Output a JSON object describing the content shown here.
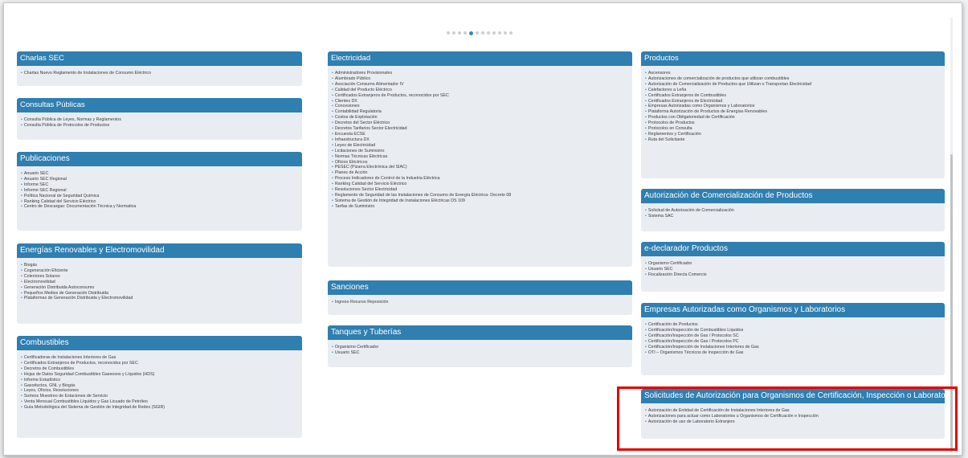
{
  "carousel": {
    "dot_count": 12,
    "active_index": 4
  },
  "columns": [
    [
      {
        "key": "charlas",
        "title": "Charlas SEC",
        "items": [
          "Charlas Nuevo Reglamento de Instalaciones de Consumo Eléctrico"
        ]
      },
      {
        "key": "consultas",
        "title": "Consultas Públicas",
        "items": [
          "Consulta Pública de Leyes, Normas y Reglamentos",
          "Consulta Pública de Protocolos de Productos"
        ]
      },
      {
        "key": "publicaciones",
        "title": "Publicaciones",
        "items": [
          "Anuario SEC",
          "Anuario SEC Regional",
          "Informe SEC",
          "Informe SEC Regional",
          "Política Nacional de Seguridad Química",
          "Ranking Calidad del Servicio Eléctrico",
          "Centro de Descargas: Documentación Técnica y Normativa"
        ]
      },
      {
        "key": "energias",
        "title": "Energías Renovables y Electromovilidad",
        "items": [
          "Biogás",
          "Cogeneración Eficiente",
          "Colectores Solares",
          "Electromovilidad",
          "Generación Distribuida Autoconsumo",
          "Pequeños Medios de Generación Distribuida",
          "Plataformas de Generación Distribuida y Electromovilidad"
        ]
      },
      {
        "key": "combustibles",
        "title": "Combustibles",
        "items": [
          "Certificadoras de Instalaciones Interiores de Gas",
          "Certificados Extranjeros de Productos, reconocidos por SEC",
          "Decretos de Combustibles",
          "Hojas de Datos Seguridad Combustibles Gaseosos y Líquidos (HDS)",
          "Informe Estadístico",
          "Gasoductos, GNL y Biogás",
          "Leyes, Oficios, Resoluciones",
          "Sorteos Muestreo de Estaciones de Servicio",
          "Venta Mensual Combustibles Líquidos y Gas Licuado de Petróleo",
          "Guía Metodológica del Sistema de Gestión de Integridad de Redes (SGIR)"
        ]
      }
    ],
    [
      {
        "key": "electricidad",
        "title": "Electricidad",
        "items": [
          "Administradores Provisionales",
          "Alumbrado Público",
          "Asociación Consumo Alimentador IV",
          "Calidad del Producto Eléctrico",
          "Certificados Extranjeros de Productos, reconocidos por SEC",
          "Clientes DX",
          "Concesiones",
          "Contabilidad Regulatoria",
          "Costos de Explotación",
          "Decretos del Sector Eléctrico",
          "Decretos Tarifarios Sector Electricidad",
          "Encuesta ECSE",
          "Infraestructura DX",
          "Leyes de Electricidad",
          "Licitaciones de Suministro",
          "Normas Técnicas Eléctricas",
          "Oficios Eléctricos",
          "PESEC (Pizarra Electrónica del SIAC)",
          "Planes de Acción",
          "Proceso Indicadores de Control de la Industria Eléctrica",
          "Ranking Calidad del Servicio Eléctrico",
          "Resoluciones Sector Electricidad",
          "Reglamento de Seguridad de las Instalaciones de Consumo de Energía Eléctrica- Decreto 08",
          "Sistema de Gestión de Integridad de Instalaciones Eléctricas DS 109",
          "Tarifas de Suministro"
        ]
      },
      {
        "key": "sanciones",
        "title": "Sanciones",
        "items": [
          "Ingreso Recurso Reposición"
        ]
      },
      {
        "key": "tanques",
        "title": "Tanques y Tuberías",
        "items": [
          "Organismo Certificador",
          "Usuario SEC"
        ]
      }
    ],
    [
      {
        "key": "productos",
        "title": "Productos",
        "items": [
          "Ascensores",
          "Autorizaciones de comercialización de productos que utilizan combustibles",
          "Autorización de Comercialización de Productos que Utilizan o Transportan Electricidad",
          "Calefactores a Leña",
          "Certificados Extranjeros de Combustibles",
          "Certificados Extranjeros de Electricidad",
          "Empresas Autorizadas como Organismos y Laboratorios",
          "Plataforma Autorización de Productos de Energías Renovables",
          "Productos con Obligatoriedad de Certificación",
          "Protocolos de Productos",
          "Protocolos en Consulta",
          "Reglamentos y Certificación",
          "Ruta del Solicitante"
        ]
      },
      {
        "key": "autorizacion",
        "title": "Autorización de Comercialización de Productos",
        "items": [
          "Solicitud de Autorización de Comercialización",
          "Sistema SAC"
        ]
      },
      {
        "key": "edeclarador",
        "title": "e-declarador Productos",
        "items": [
          "Organismo Certificador",
          "Usuario SEC",
          "Fiscalización Directa Comercio"
        ]
      },
      {
        "key": "empresas",
        "title": "Empresas Autorizadas como Organismos y Laboratorios",
        "items": [
          "Certificación de Productos",
          "Certificación/Inspección de Combustibles Líquidos",
          "Certificación/Inspección de Gas / Protocolos SC",
          "Certificación/Inspección de Gas / Protocolos PC",
          "Certificación/Inspección de Instalaciones Interiores de Gas",
          "OTI – Organismos Técnicos de Inspección de Gas"
        ]
      },
      {
        "key": "solicitudes",
        "title": "Solicitudes de Autorización para Organismos de Certificación, Inspección o Laboratorios",
        "items": [
          "Autorización de Entidad de Certificación de Instalaciones Interiores de Gas",
          "Autorizaciones para actuar como Laboratorios u Organismos de Certificación e Inspección",
          "Autorización de uso de Laboratorio Extranjero"
        ]
      }
    ]
  ]
}
